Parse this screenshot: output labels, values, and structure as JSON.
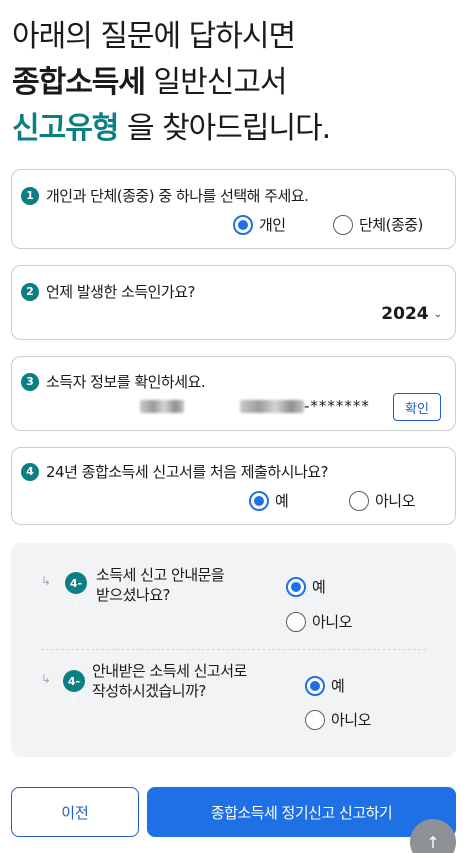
{
  "heading": {
    "line1": "아래의 질문에 답하시면",
    "line2_bold": "종합소득세",
    "line2_rest": " 일반신고서",
    "line3_accent": "신고유형",
    "line3_rest": " 을 찾아드립니다."
  },
  "q1": {
    "num": "1",
    "text": "개인과 단체(종중) 중 하나를 선택해 주세요.",
    "options": [
      {
        "label": "개인",
        "selected": true
      },
      {
        "label": "단체(종중)",
        "selected": false
      }
    ]
  },
  "q2": {
    "num": "2",
    "text": "언제 발생한 소득인가요?",
    "year": "2024",
    "chevron": "⌄"
  },
  "q3": {
    "num": "3",
    "text": "소득자 정보를 확인하세요.",
    "masked_suffix": "-*******",
    "confirm_label": "확인"
  },
  "q4": {
    "num": "4",
    "text": "24년 종합소득세 신고서를 처음 제출하시나요?",
    "options": [
      {
        "label": "예",
        "selected": true
      },
      {
        "label": "아니오",
        "selected": false
      }
    ]
  },
  "sub_questions": [
    {
      "arrow": "↳",
      "badge": "4-",
      "badge_sub": "1",
      "text_line1": "소득세 신고 안내문을",
      "text_line2": "받으셨나요?",
      "options": [
        {
          "label": "예",
          "selected": true
        },
        {
          "label": "아니오",
          "selected": false
        }
      ]
    },
    {
      "arrow": "↳",
      "badge": "4-",
      "badge_sub": "2",
      "text_line1": "안내받은 소득세 신고서로",
      "text_line2": "작성하시겠습니까?",
      "options": [
        {
          "label": "예",
          "selected": true
        },
        {
          "label": "아니오",
          "selected": false
        }
      ]
    }
  ],
  "buttons": {
    "prev_label": "이전",
    "submit_label": "종합소득세 정기신고 신고하기",
    "scroll_top_icon": "↑"
  },
  "colors": {
    "accent_teal": "#0b7f83",
    "primary_blue": "#1f6fe5"
  }
}
